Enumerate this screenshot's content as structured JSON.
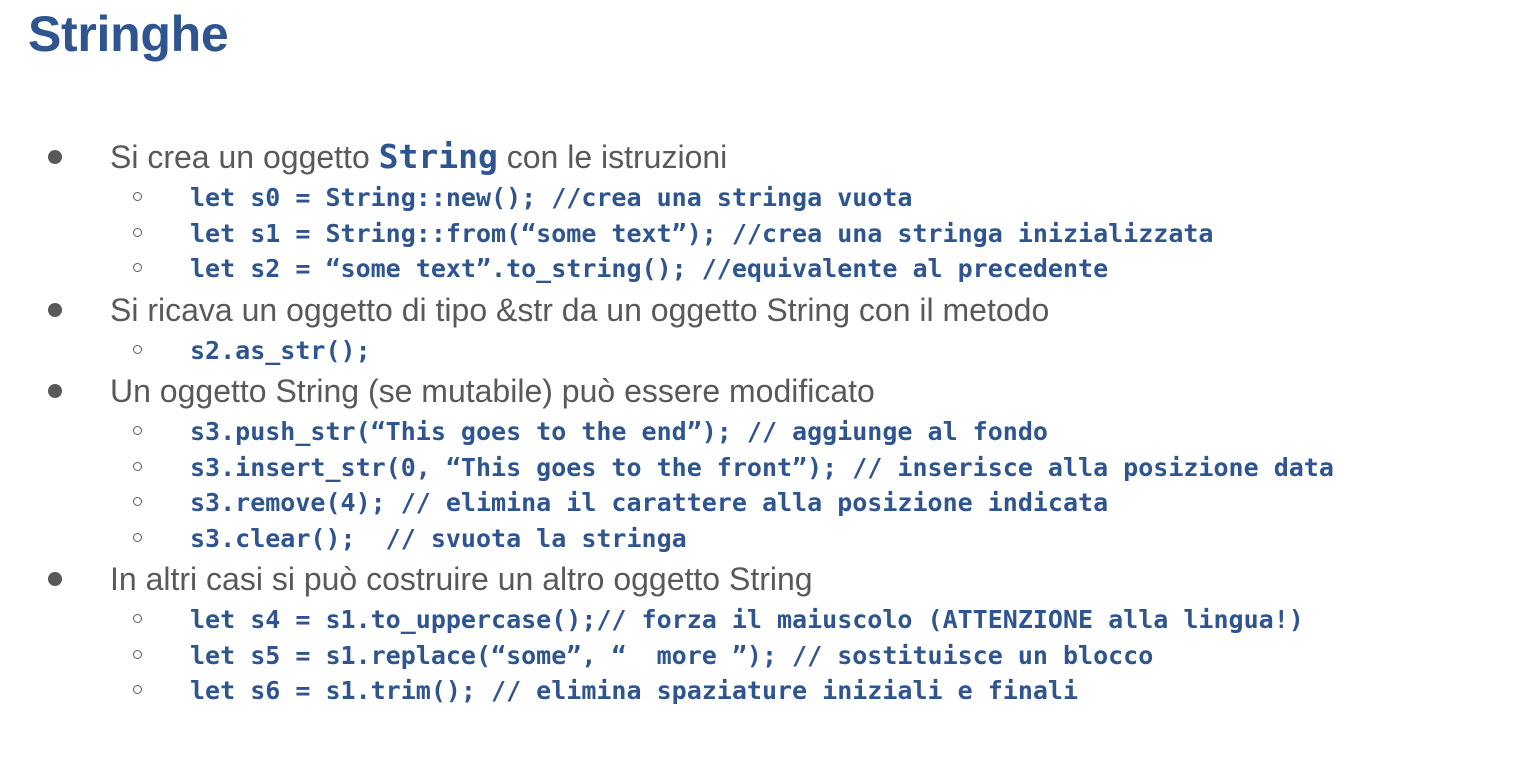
{
  "title": "Stringhe",
  "bullets": [
    {
      "text_before": "Si crea un oggetto ",
      "code": "String",
      "text_after": " con le istruzioni",
      "items": [
        "let s0 = String::new(); //crea una stringa vuota",
        "let s1 = String::from(“some text”); //crea una stringa inizializzata",
        "let s2 = “some text”.to_string(); //equivalente al precedente"
      ]
    },
    {
      "text": "Si ricava un oggetto di tipo &str da un oggetto String con il metodo",
      "items": [
        "s2.as_str();"
      ]
    },
    {
      "text": "Un oggetto String (se mutabile) può essere modificato",
      "items": [
        "s3.push_str(“This goes to the end”); // aggiunge al fondo",
        "s3.insert_str(0, “This goes to the front”); // inserisce alla posizione data",
        "s3.remove(4); // elimina il carattere alla posizione indicata",
        "s3.clear();  // svuota la stringa"
      ]
    },
    {
      "text": "In altri casi si può costruire un altro oggetto String",
      "items": [
        "let s4 = s1.to_uppercase();// forza il maiuscolo (ATTENZIONE alla lingua!)",
        "let s5 = s1.replace(“some”, “  more ”); // sostituisce un blocco",
        "let s6 = s1.trim(); // elimina spaziature iniziali e finali"
      ]
    }
  ]
}
